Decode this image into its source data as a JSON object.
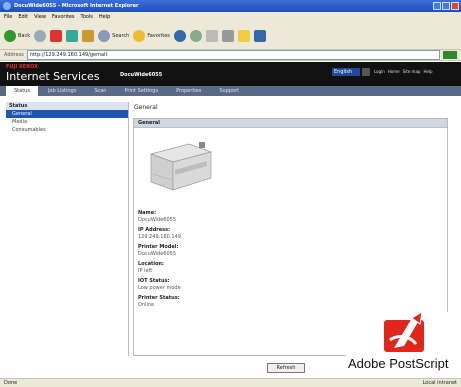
{
  "window": {
    "title": "DocuWide6055 - Microsoft Internet Explorer"
  },
  "menu": [
    "File",
    "Edit",
    "View",
    "Favorites",
    "Tools",
    "Help"
  ],
  "toolbar": {
    "back": "Back",
    "search": "Search",
    "favorites": "Favorites"
  },
  "address": {
    "label": "Address",
    "url": "http://129.249.160.149/gemait",
    "go": "Go"
  },
  "header": {
    "brand_top": "FUJI XEROX",
    "brand": "Internet Services",
    "product": "DocuWide6055",
    "language": "English",
    "links": [
      "Login",
      "Home",
      "Site map",
      "Help"
    ]
  },
  "tabs": [
    "Status",
    "Job Listings",
    "Scan",
    "Print Settings",
    "Properties",
    "Support"
  ],
  "sidebar": {
    "heading": "Status",
    "items": [
      "General",
      "Media",
      "Consumables"
    ]
  },
  "main": {
    "title": "General",
    "panel_title": "General"
  },
  "fields": [
    {
      "label": "Name:",
      "value": "DocuWide6055"
    },
    {
      "label": "IP Address:",
      "value": "129.249.160.149"
    },
    {
      "label": "Printer Model:",
      "value": "DocuWide6055"
    },
    {
      "label": "Location:",
      "value": "IP left"
    },
    {
      "label": "IOT Status:",
      "value": "Low power mode"
    },
    {
      "label": "Printer Status:",
      "value": "Online"
    }
  ],
  "refresh_label": "Refresh",
  "status": {
    "left": "Done",
    "right": "Local intranet"
  },
  "logo": {
    "text": "Adobe PostScript",
    "color": "#e1261c"
  }
}
